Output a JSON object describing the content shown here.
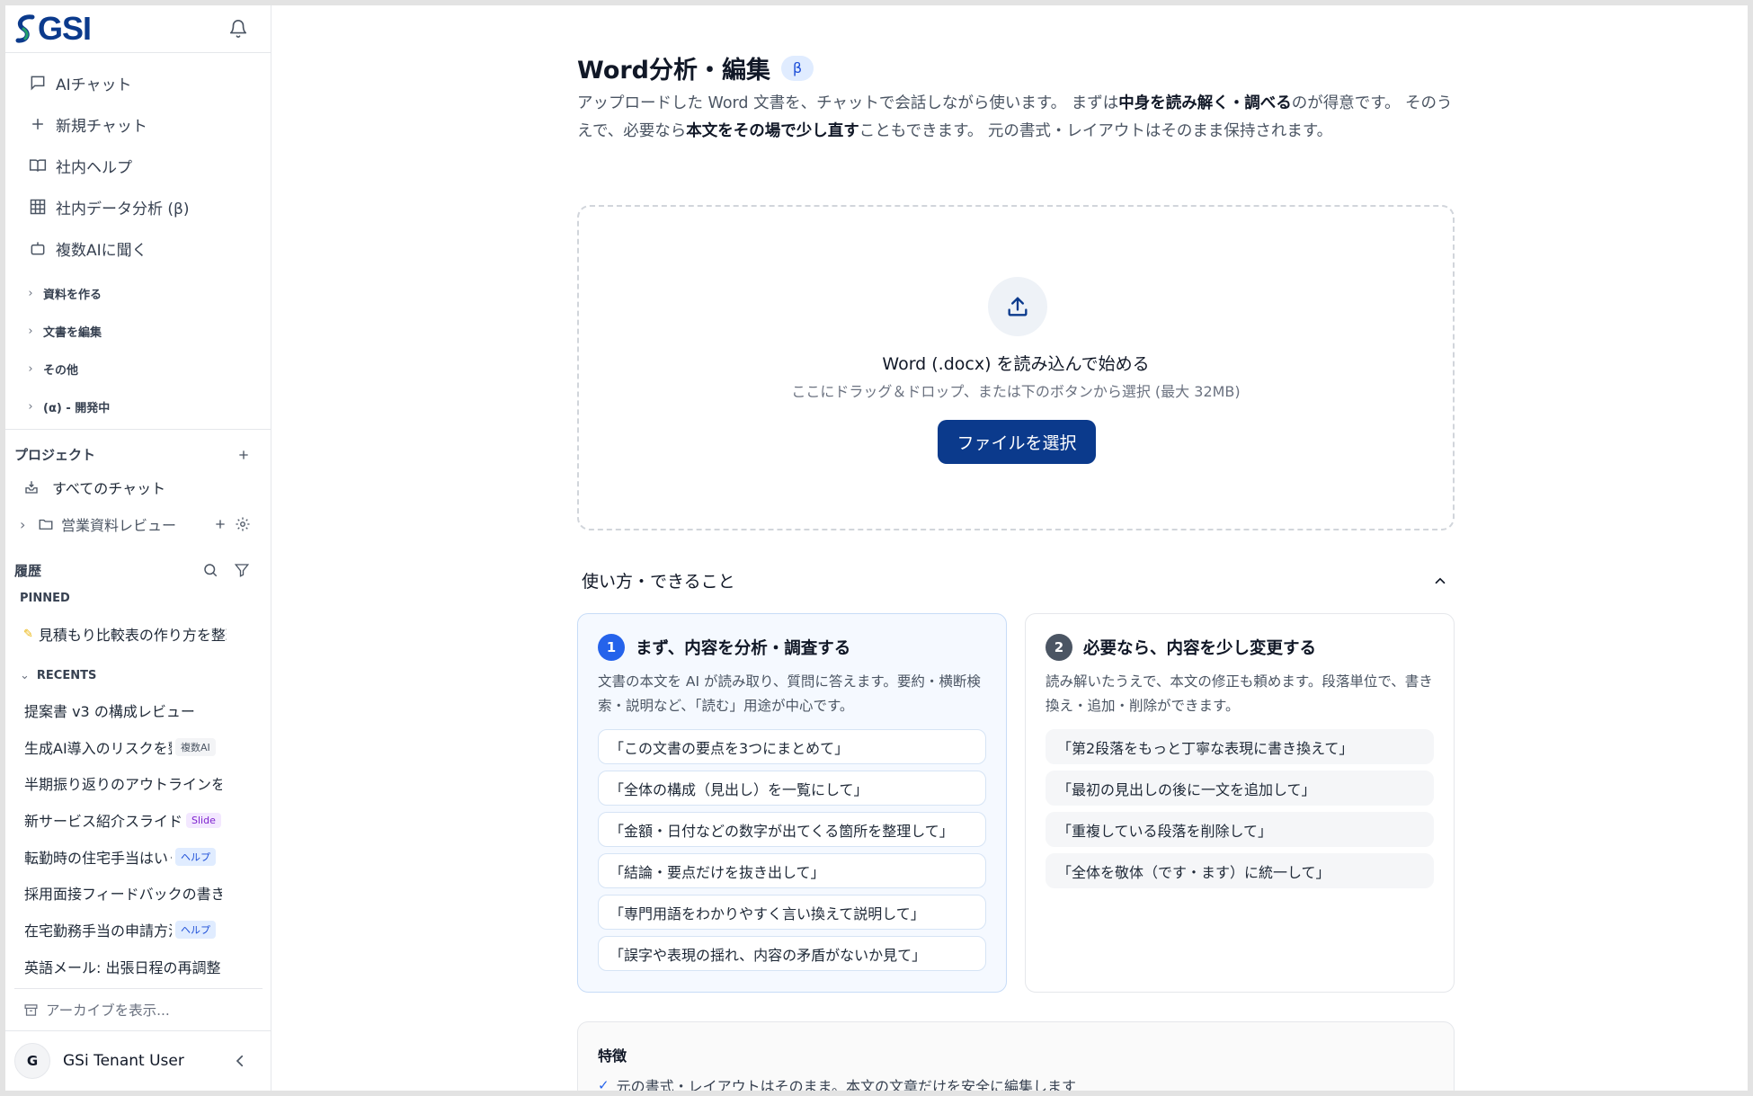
{
  "brand": {
    "logo_text": "GSI",
    "accent": "#0b3a8c"
  },
  "sidebar": {
    "nav": [
      {
        "label": "AIチャット",
        "icon": "chat-bubble-icon"
      },
      {
        "label": "新規チャット",
        "icon": "plus-icon"
      },
      {
        "label": "社内ヘルプ",
        "icon": "book-icon"
      },
      {
        "label": "社内データ分析 (β)",
        "icon": "table-icon"
      },
      {
        "label": "複数AIに聞く",
        "icon": "robot-icon"
      }
    ],
    "sections": [
      {
        "label": "資料を作る"
      },
      {
        "label": "文書を編集"
      },
      {
        "label": "その他"
      },
      {
        "label": "(α) - 開発中"
      }
    ],
    "projects": {
      "title": "プロジェクト",
      "all_chats": "すべてのチャット",
      "folder": "営業資料レビュー"
    },
    "history": {
      "title": "履歴",
      "pinned_label": "PINNED",
      "pinned": [
        {
          "label": "見積もり比較表の作り方を整理"
        }
      ],
      "recents_label": "RECENTS",
      "recents": [
        {
          "label": "提案書 v3 の構成レビュー",
          "badge": ""
        },
        {
          "label": "生成AI導入のリスクを整理",
          "badge": "複数AI"
        },
        {
          "label": "半期振り返りのアウトラインを作成",
          "badge": ""
        },
        {
          "label": "新サービス紹介スライド",
          "badge": "Slide"
        },
        {
          "label": "転勤時の住宅手当はいくら",
          "badge": "ヘルプ"
        },
        {
          "label": "採用面接フィードバックの書き方",
          "badge": ""
        },
        {
          "label": "在宅勤務手当の申請方法",
          "badge": "ヘルプ"
        },
        {
          "label": "英語メール: 出張日程の再調整",
          "badge": ""
        }
      ],
      "archive": "アーカイブを表示..."
    },
    "user": {
      "initial": "G",
      "name": "GSi Tenant User"
    }
  },
  "main": {
    "title": "Word分析・編集",
    "beta": "β",
    "desc": {
      "p1": "アップロードした Word 文書を、チャットで会話しながら使います。 まずは",
      "b1": "中身を読み解く・調べる",
      "p2": "のが得意です。 そのうえで、必要なら",
      "b2": "本文をその場で少し直す",
      "p3": "こともできます。 元の書式・レイアウトはそのまま保持されます。"
    },
    "dropzone": {
      "title": "Word (.docx) を読み込んで始める",
      "subtitle": "ここにドラッグ＆ドロップ、または下のボタンから選択 (最大 32MB)",
      "button": "ファイルを選択"
    },
    "howto_title": "使い方・できること",
    "cards": [
      {
        "num": "1",
        "title": "まず、内容を分析・調査する",
        "desc": "文書の本文を AI が読み取り、質問に答えます。要約・横断検索・説明など、「読む」用途が中心です。",
        "chips": [
          "「この文書の要点を3つにまとめて」",
          "「全体の構成（見出し）を一覧にして」",
          "「金額・日付などの数字が出てくる箇所を整理して」",
          "「結論・要点だけを抜き出して」",
          "「専門用語をわかりやすく言い換えて説明して」",
          "「誤字や表現の揺れ、内容の矛盾がないか見て」"
        ]
      },
      {
        "num": "2",
        "title": "必要なら、内容を少し変更する",
        "desc": "読み解いたうえで、本文の修正も頼めます。段落単位で、書き換え・追加・削除ができます。",
        "chips": [
          "「第2段落をもっと丁寧な表現に書き換えて」",
          "「最初の見出しの後に一文を追加して」",
          "「重複している段落を削除して」",
          "「全体を敬体（です・ます）に統一して」"
        ]
      }
    ],
    "features": {
      "title": "特徴",
      "item1": "元の書式・レイアウトはそのまま。本文の文章だけを安全に編集します"
    }
  }
}
